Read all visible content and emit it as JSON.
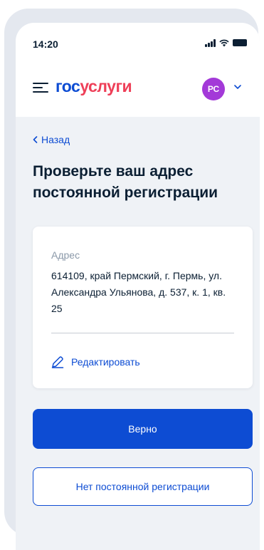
{
  "status_bar": {
    "time": "14:20"
  },
  "header": {
    "logo_part1": "гос",
    "logo_part2": "услуги",
    "avatar_initials": "РС",
    "colors": {
      "brand_blue": "#0d4cd3",
      "brand_red": "#ee3f58",
      "avatar": "#a339d8"
    }
  },
  "nav": {
    "back_label": "Назад"
  },
  "page": {
    "title": "Проверьте ваш адрес постоянной регистрации"
  },
  "address_card": {
    "label": "Адрес",
    "value": "614109, край Пермский, г. Пермь, ул. Александра Ульянова, д. 537, к. 1, кв. 25",
    "edit_label": "Редактировать",
    "edit_icon": "pencil-icon"
  },
  "actions": {
    "confirm_label": "Верно",
    "no_registration_label": "Нет постоянной регистрации"
  }
}
